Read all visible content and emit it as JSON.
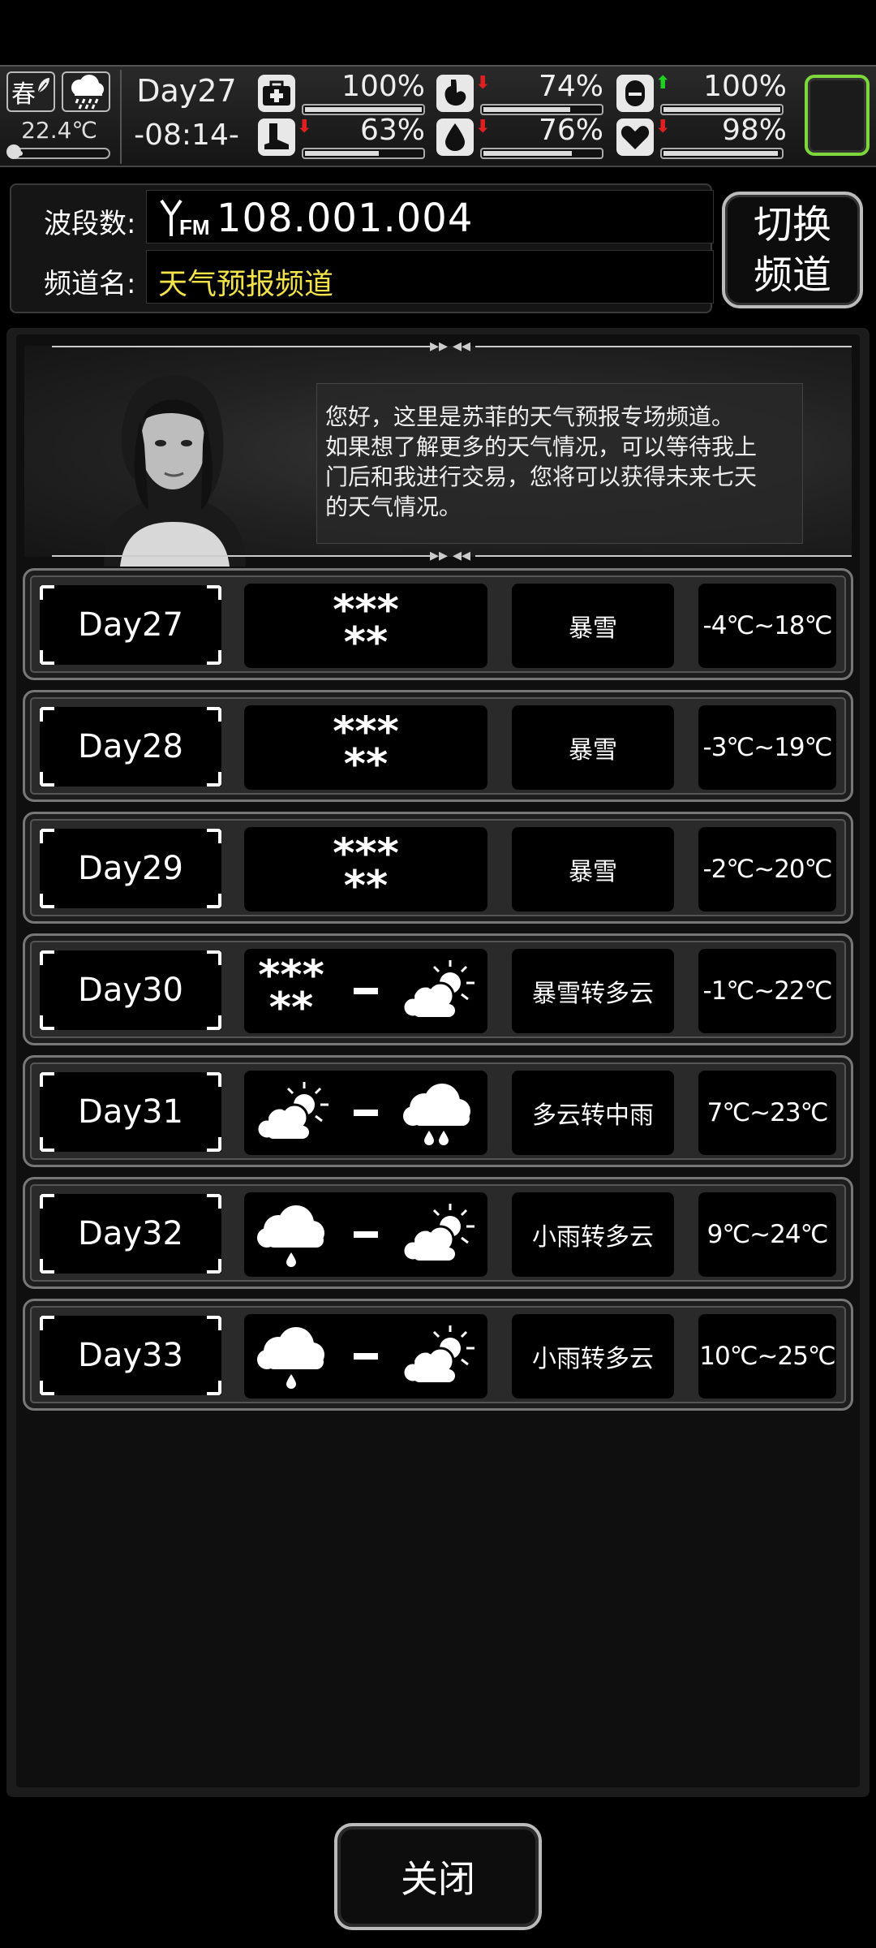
{
  "status": {
    "season": "春",
    "temperature": "22.4℃",
    "day": "Day27",
    "time": "-08:14-",
    "stats": [
      {
        "name": "health",
        "icon": "medkit-icon",
        "value": "100%",
        "level": 1.0,
        "trend": ""
      },
      {
        "name": "hunger",
        "icon": "stomach-icon",
        "value": "74%",
        "level": 0.74,
        "trend": "down"
      },
      {
        "name": "medicine",
        "icon": "pill-icon",
        "value": "100%",
        "level": 1.0,
        "trend": "up"
      },
      {
        "name": "stamina",
        "icon": "boot-icon",
        "value": "63%",
        "level": 0.63,
        "trend": "down"
      },
      {
        "name": "thirst",
        "icon": "water-drop-icon",
        "value": "76%",
        "level": 0.76,
        "trend": "down"
      },
      {
        "name": "mood",
        "icon": "heart-icon",
        "value": "98%",
        "level": 0.98,
        "trend": "down"
      }
    ]
  },
  "radio": {
    "frequency_label": "波段数:",
    "frequency_value": "108.001.004",
    "channel_label": "频道名:",
    "channel_value": "天气预报频道",
    "switch_button_line1": "切换",
    "switch_button_line2": "频道"
  },
  "host": {
    "message_line1": "您好，这里是苏菲的天气预报专场频道。",
    "message_line2": "如果想了解更多的天气情况，可以等待我上",
    "message_line3": "门后和我进行交易，您将可以获得未来七天",
    "message_line4": "的天气情况。"
  },
  "forecast": [
    {
      "day": "Day27",
      "icons": [
        "snowstorm"
      ],
      "description": "暴雪",
      "range": "-4℃~18℃"
    },
    {
      "day": "Day28",
      "icons": [
        "snowstorm"
      ],
      "description": "暴雪",
      "range": "-3℃~19℃"
    },
    {
      "day": "Day29",
      "icons": [
        "snowstorm"
      ],
      "description": "暴雪",
      "range": "-2℃~20℃"
    },
    {
      "day": "Day30",
      "icons": [
        "snowstorm",
        "partly-cloudy"
      ],
      "description": "暴雪转多云",
      "range": "-1℃~22℃"
    },
    {
      "day": "Day31",
      "icons": [
        "partly-cloudy",
        "moderate-rain"
      ],
      "description": "多云转中雨",
      "range": "7℃~23℃"
    },
    {
      "day": "Day32",
      "icons": [
        "light-rain",
        "partly-cloudy"
      ],
      "description": "小雨转多云",
      "range": "9℃~24℃"
    },
    {
      "day": "Day33",
      "icons": [
        "light-rain",
        "partly-cloudy"
      ],
      "description": "小雨转多云",
      "range": "10℃~25℃"
    }
  ],
  "close_label": "关闭"
}
